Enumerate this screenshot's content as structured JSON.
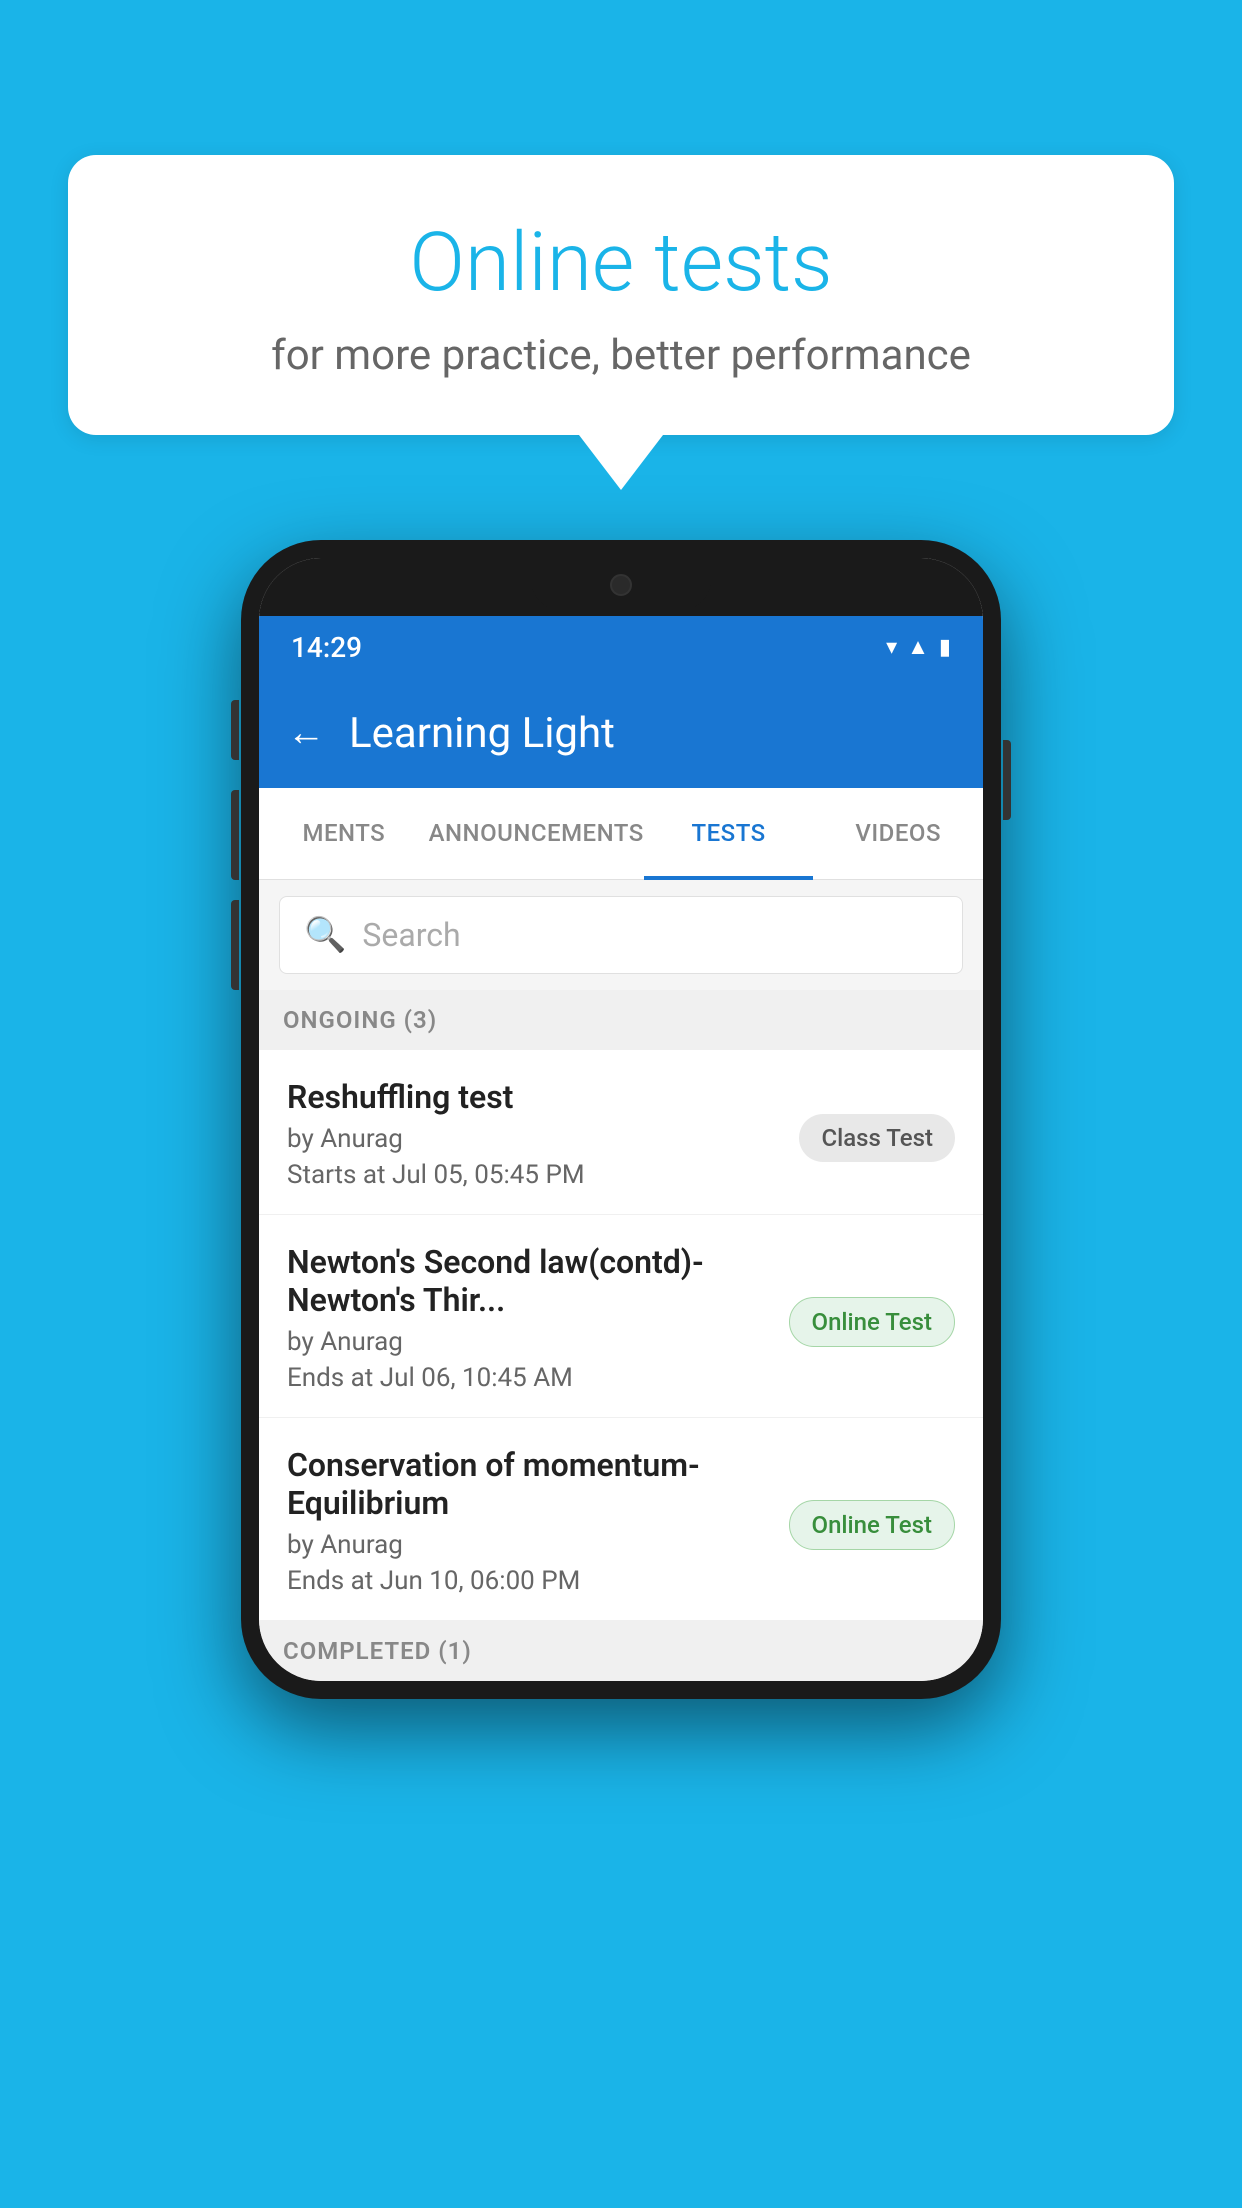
{
  "background_color": "#1ab4e8",
  "speech_bubble": {
    "title": "Online tests",
    "subtitle": "for more practice, better performance"
  },
  "phone": {
    "status_bar": {
      "time": "14:29",
      "icons": [
        "wifi",
        "signal",
        "battery"
      ]
    },
    "app_bar": {
      "back_label": "←",
      "title": "Learning Light"
    },
    "tabs": [
      {
        "label": "MENTS",
        "active": false
      },
      {
        "label": "ANNOUNCEMENTS",
        "active": false
      },
      {
        "label": "TESTS",
        "active": true
      },
      {
        "label": "VIDEOS",
        "active": false
      }
    ],
    "search": {
      "placeholder": "Search"
    },
    "ongoing_section": {
      "header": "ONGOING (3)",
      "tests": [
        {
          "title": "Reshuffling test",
          "author": "by Anurag",
          "date": "Starts at  Jul 05, 05:45 PM",
          "badge": "Class Test",
          "badge_type": "class"
        },
        {
          "title": "Newton's Second law(contd)-Newton's Thir...",
          "author": "by Anurag",
          "date": "Ends at  Jul 06, 10:45 AM",
          "badge": "Online Test",
          "badge_type": "online"
        },
        {
          "title": "Conservation of momentum-Equilibrium",
          "author": "by Anurag",
          "date": "Ends at  Jun 10, 06:00 PM",
          "badge": "Online Test",
          "badge_type": "online"
        }
      ]
    },
    "completed_section": {
      "header": "COMPLETED (1)"
    }
  }
}
